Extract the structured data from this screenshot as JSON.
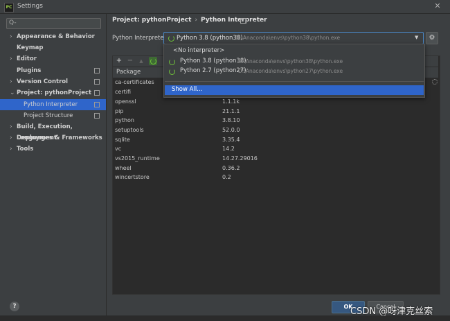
{
  "window": {
    "title": "Settings",
    "app_icon_text": "PC"
  },
  "search": {
    "placeholder": "Q-"
  },
  "sidebar": {
    "items": [
      {
        "label": "Appearance & Behavior",
        "arrow": "›"
      },
      {
        "label": "Keymap",
        "arrow": ""
      },
      {
        "label": "Editor",
        "arrow": "›"
      },
      {
        "label": "Plugins",
        "arrow": ""
      },
      {
        "label": "Version Control",
        "arrow": "›"
      },
      {
        "label": "Project: pythonProject",
        "arrow": "⌄"
      },
      {
        "label": "Python Interpreter",
        "arrow": ""
      },
      {
        "label": "Project Structure",
        "arrow": ""
      },
      {
        "label": "Build, Execution, Deployment",
        "arrow": "›"
      },
      {
        "label": "Languages & Frameworks",
        "arrow": "›"
      },
      {
        "label": "Tools",
        "arrow": "›"
      }
    ],
    "selected": "Python Interpreter"
  },
  "breadcrumb": {
    "project": "Project: pythonProject",
    "separator": "›",
    "page": "Python Interpreter"
  },
  "interpreter": {
    "label": "Python Interpreter:",
    "selected_name": "Python 3.8 (python38)",
    "selected_path": "D:\\Anaconda\\envs\\python38\\python.exe"
  },
  "dropdown": {
    "no_interpreter": "<No interpreter>",
    "options": [
      {
        "name": "Python 3.8 (python38)",
        "path": "D:\\Anaconda\\envs\\python38\\python.exe"
      },
      {
        "name": "Python 2.7 (python27)",
        "path": "D:\\Anaconda\\envs\\python27\\python.exe"
      }
    ],
    "show_all": "Show All..."
  },
  "toolbar": {
    "add": "+",
    "remove": "−",
    "up": "▲"
  },
  "table": {
    "column_package": "Package",
    "rows": [
      {
        "name": "ca-certificates",
        "version": ""
      },
      {
        "name": "certifi",
        "version": ""
      },
      {
        "name": "openssl",
        "version": "1.1.1k"
      },
      {
        "name": "pip",
        "version": "21.1.1"
      },
      {
        "name": "python",
        "version": "3.8.10"
      },
      {
        "name": "setuptools",
        "version": "52.0.0"
      },
      {
        "name": "sqlite",
        "version": "3.35.4"
      },
      {
        "name": "vc",
        "version": "14.2"
      },
      {
        "name": "vs2015_runtime",
        "version": "14.27.29016"
      },
      {
        "name": "wheel",
        "version": "0.36.2"
      },
      {
        "name": "wincertstore",
        "version": "0.2"
      }
    ]
  },
  "buttons": {
    "ok": "OK",
    "cancel": "Cancel",
    "help": "?"
  },
  "watermark": "CSDN @呀津克丝索",
  "colors": {
    "selection": "#2f65ca",
    "ok": "#365880",
    "accent_green": "#6fbf3a"
  }
}
